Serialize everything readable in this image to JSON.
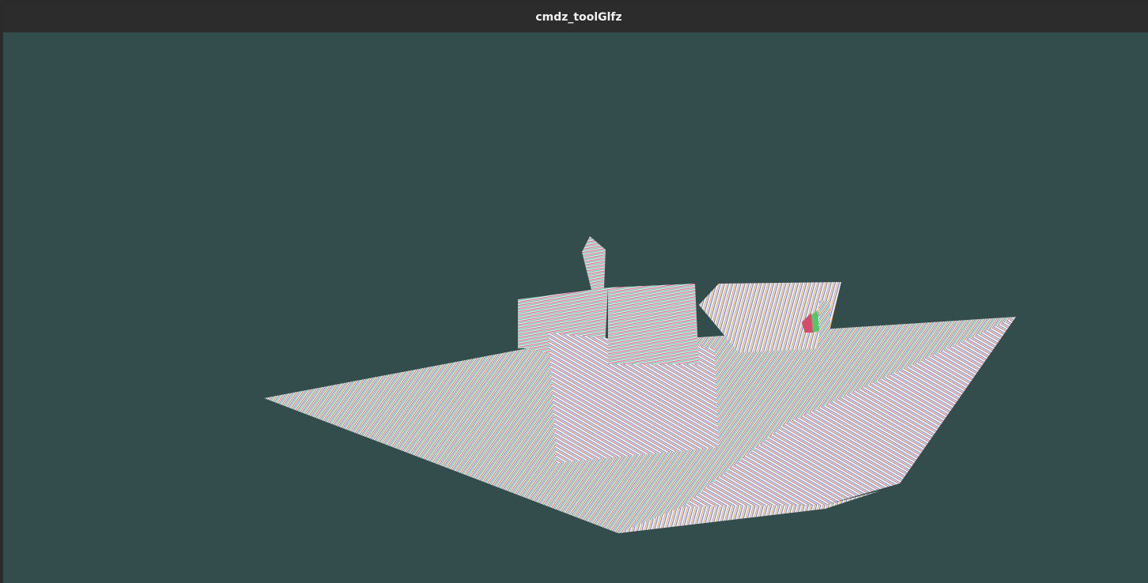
{
  "window": {
    "title": "cmdz_toolGlfz"
  },
  "viewport": {
    "background_color": "#334d4d",
    "render_style": "rainbow-striped-wireframe",
    "model": "boat"
  }
}
